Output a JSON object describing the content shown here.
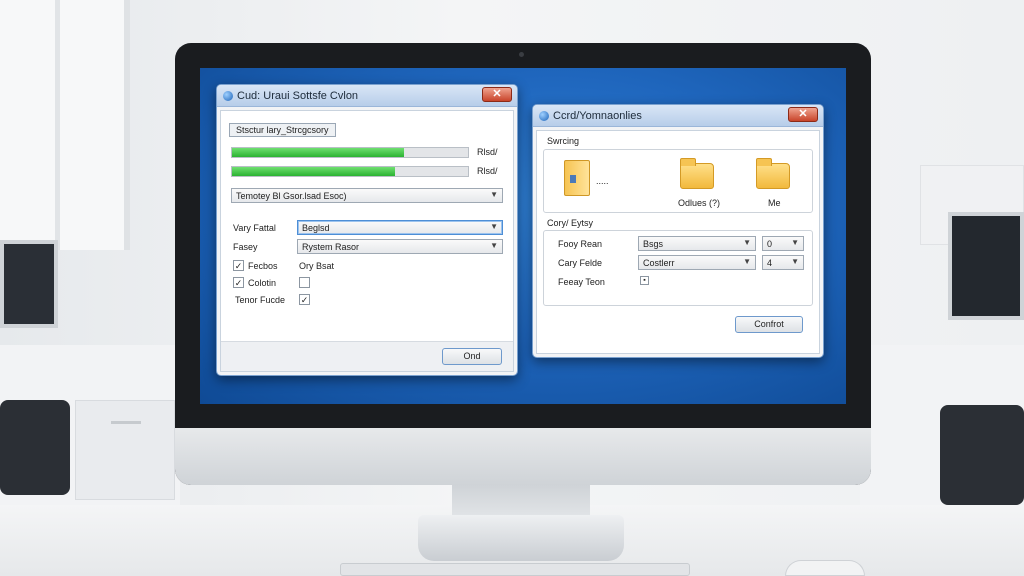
{
  "left_dialog": {
    "title": "Cud: Uraui Sottsfe Cvlon",
    "close_label": "✕",
    "section_label": "Stsctur lary_Strcgcsory",
    "progress": [
      {
        "value": 0.73,
        "label": "Rlsd/"
      },
      {
        "value": 0.69,
        "label": "Rlsd/"
      }
    ],
    "main_dropdown": "Temotey Bl Gsor.lsad Esoc)",
    "rows": [
      {
        "label": "Vary Fattal",
        "value": "Beglsd"
      },
      {
        "label": "Fasey",
        "value": "Rystem Rasor"
      }
    ],
    "checks": [
      {
        "label": "Fecbos",
        "checked": true,
        "right_text": "Ory Bsat"
      },
      {
        "label": "Colotin",
        "checked": true,
        "right_checked": false
      },
      {
        "label": "Tenor Fucde",
        "right_checked": true
      }
    ],
    "ok_button": "Ond"
  },
  "right_dialog": {
    "title": "Ccrd/Yomnaonlies",
    "close_label": "✕",
    "section1_label": "Swrcing",
    "file_dots": ".....",
    "folders": [
      {
        "label": "Odlues (?)"
      },
      {
        "label": "Me"
      }
    ],
    "section2_label": "Cory/ Eytsy",
    "rows": [
      {
        "label": "Fooy Rean",
        "value": "Bsgs",
        "num": "0"
      },
      {
        "label": "Cary Felde",
        "value": "Costlerr",
        "num": "4"
      },
      {
        "label": "Feeay Teon"
      }
    ],
    "confirm_button": "Confrot"
  }
}
